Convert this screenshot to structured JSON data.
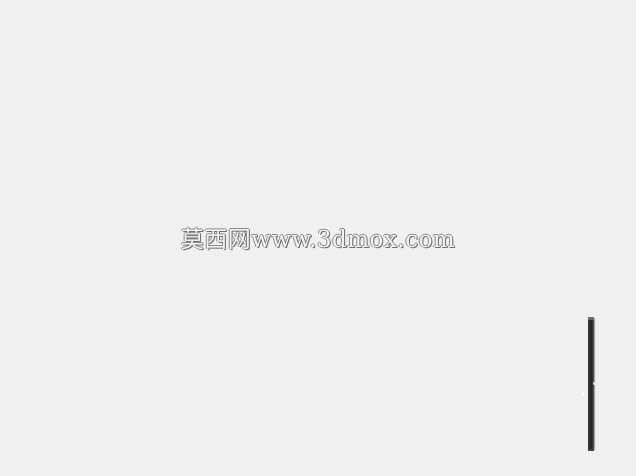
{
  "viewport": {
    "watermark_text": "莫西网www.3dmox.com"
  },
  "colors": {
    "background": "#f0f0f0",
    "object_dark": "#222222"
  },
  "icons": {
    "object": "panel-edge-object"
  }
}
